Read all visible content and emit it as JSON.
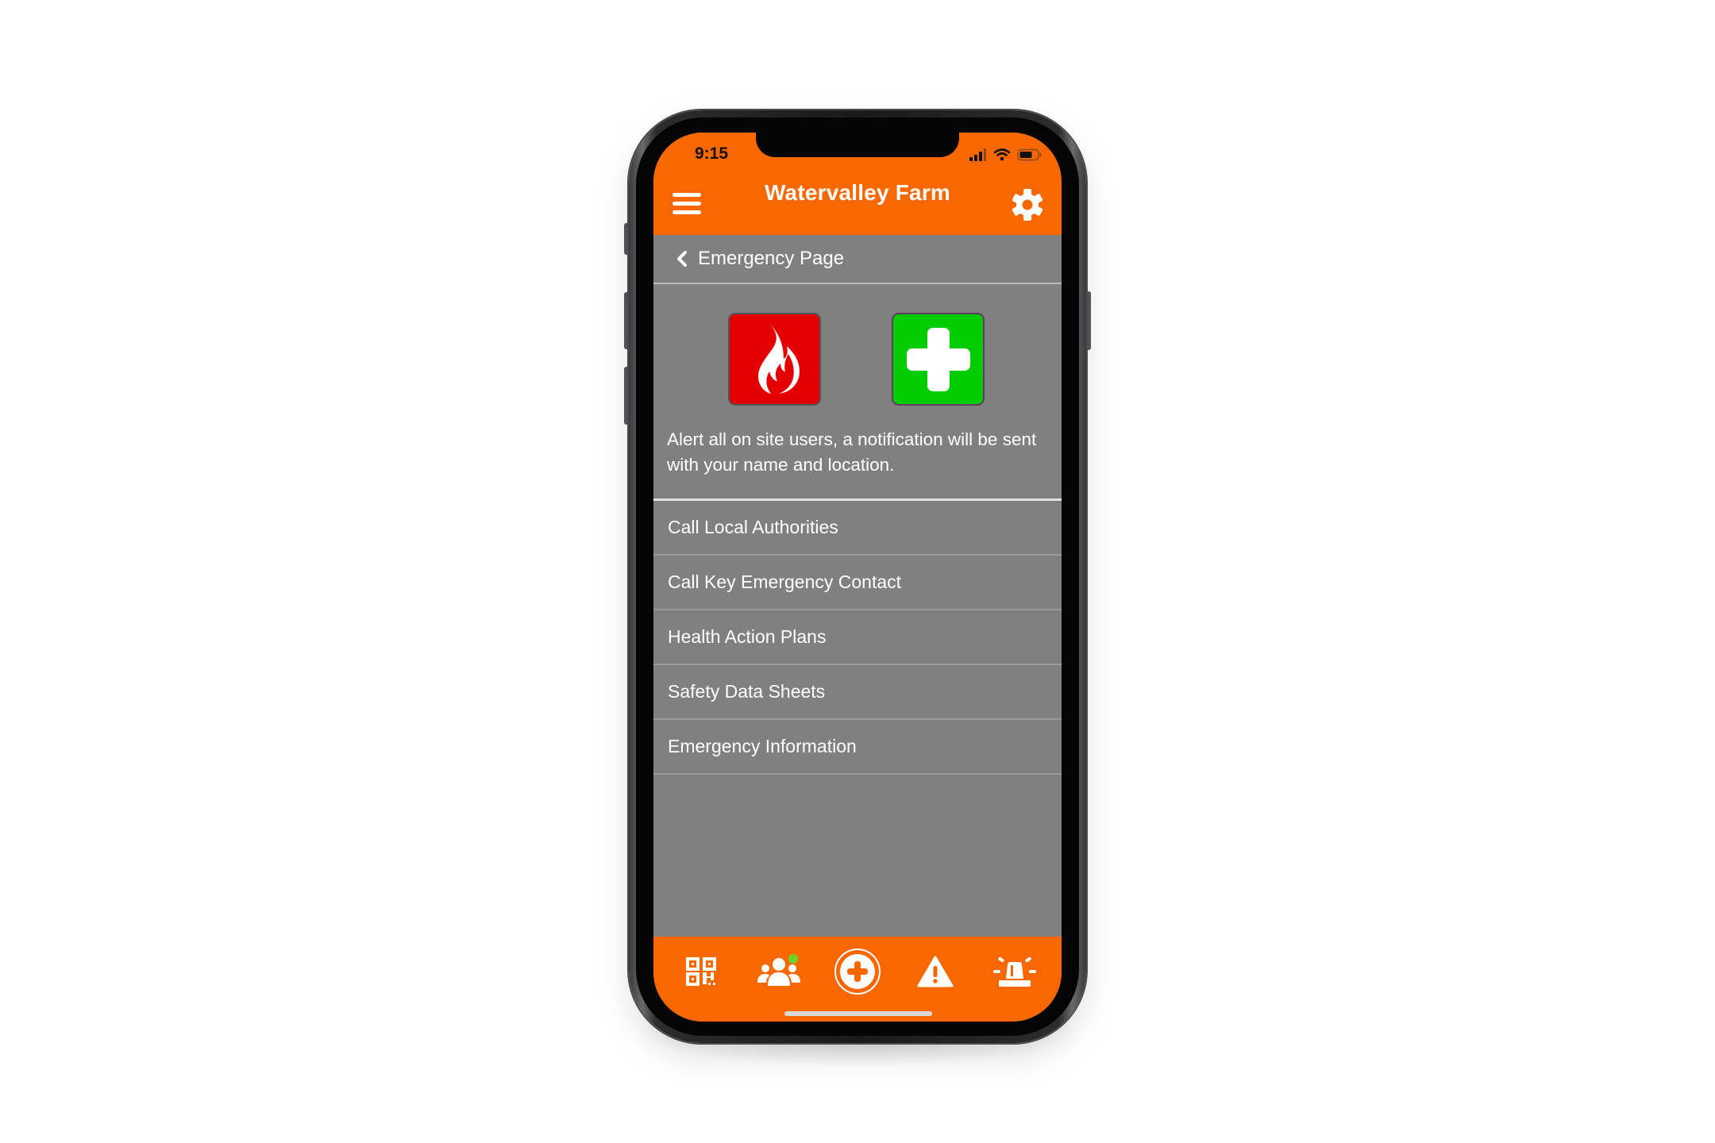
{
  "status_bar": {
    "time": "9:15",
    "icons": [
      "signal-icon",
      "wifi-icon",
      "battery-icon"
    ]
  },
  "header": {
    "title": "Watervalley Farm",
    "menu_icon": "hamburger-menu-icon",
    "settings_icon": "gear-icon"
  },
  "breadcrumb": {
    "back_icon": "chevron-left-icon",
    "label": "Emergency Page"
  },
  "alert_buttons": [
    {
      "name": "fire-alert",
      "icon": "flame-icon",
      "color": "#e50000"
    },
    {
      "name": "first-aid-alert",
      "icon": "medical-cross-icon",
      "color": "#00cc00"
    }
  ],
  "alert_description": "Alert all on site users, a notification will be sent with your name and location.",
  "menu": {
    "items": [
      {
        "label": "Call Local Authorities"
      },
      {
        "label": "Call Key Emergency Contact"
      },
      {
        "label": "Health Action Plans"
      },
      {
        "label": "Safety Data Sheets"
      },
      {
        "label": "Emergency Information"
      }
    ]
  },
  "bottom_nav": {
    "items": [
      {
        "icon": "qr-code-icon"
      },
      {
        "icon": "users-group-icon",
        "badge_color": "#6bd22a"
      },
      {
        "icon": "plus-circle-icon",
        "active": true
      },
      {
        "icon": "warning-triangle-icon"
      },
      {
        "icon": "siren-icon"
      }
    ]
  },
  "theme": {
    "accent": "#f96800",
    "content_bg": "#808080",
    "text": "#ffffff"
  }
}
